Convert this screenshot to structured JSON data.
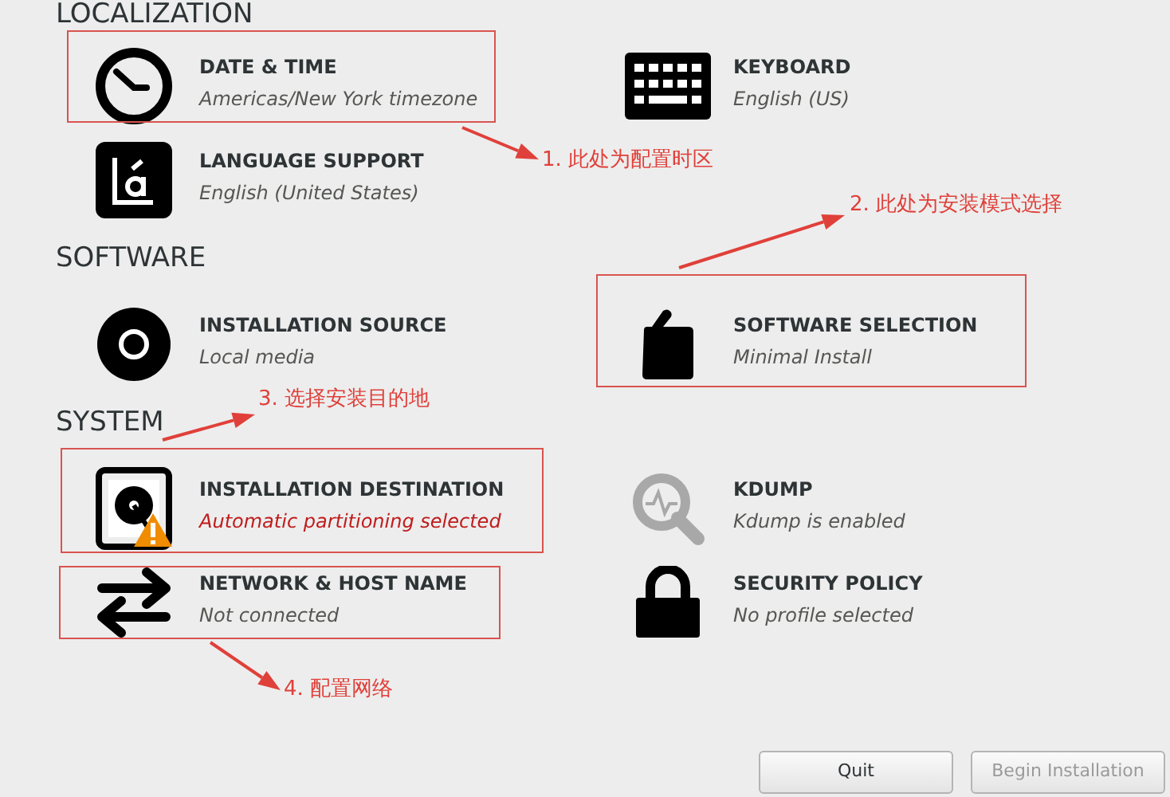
{
  "sections": [
    {
      "title": "LOCALIZATION",
      "items": [
        {
          "title": "DATE & TIME",
          "status": "Americas/New York timezone",
          "warning": false
        },
        {
          "title": "KEYBOARD",
          "status": "English (US)",
          "warning": false
        },
        {
          "title": "LANGUAGE SUPPORT",
          "status": "English (United States)",
          "warning": false
        }
      ]
    },
    {
      "title": "SOFTWARE",
      "items": [
        {
          "title": "INSTALLATION SOURCE",
          "status": "Local media",
          "warning": false
        },
        {
          "title": "SOFTWARE SELECTION",
          "status": "Minimal Install",
          "warning": false
        }
      ]
    },
    {
      "title": "SYSTEM",
      "items": [
        {
          "title": "INSTALLATION DESTINATION",
          "status": "Automatic partitioning selected",
          "warning": true
        },
        {
          "title": "KDUMP",
          "status": "Kdump is enabled",
          "warning": false
        },
        {
          "title": "NETWORK & HOST NAME",
          "status": "Not connected",
          "warning": false
        },
        {
          "title": "SECURITY POLICY",
          "status": "No profile selected",
          "warning": false
        }
      ]
    }
  ],
  "annotations": [
    {
      "text": "1. 此处为配置时区"
    },
    {
      "text": "2. 此处为安装模式选择"
    },
    {
      "text": "3. 选择安装目的地"
    },
    {
      "text": "4. 配置网络"
    }
  ],
  "buttons": [
    {
      "label": "Quit",
      "disabled": false
    },
    {
      "label": "Begin Installation",
      "disabled": true
    }
  ]
}
